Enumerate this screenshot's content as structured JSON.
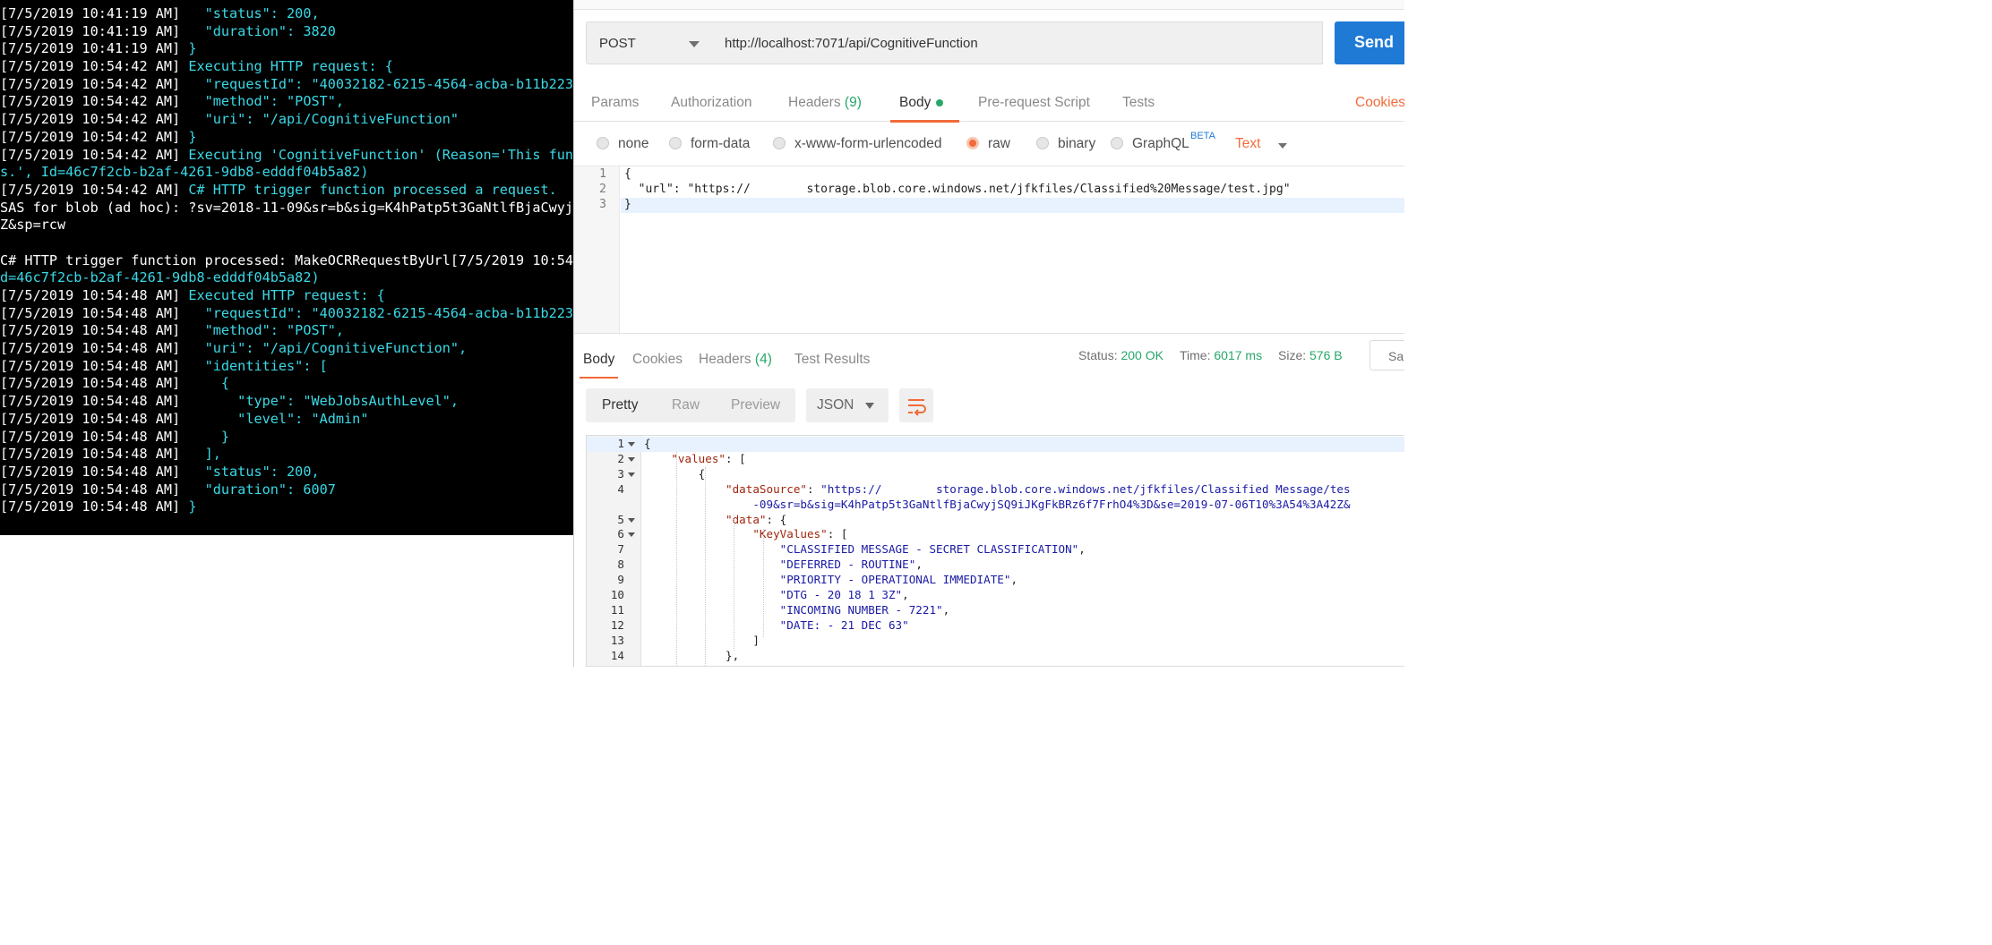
{
  "console": {
    "lines": [
      [
        {
          "t": "[7/5/2019 10:41:19 AM] ",
          "c": "ts"
        },
        {
          "t": "  \"status\": 200,",
          "c": "c"
        }
      ],
      [
        {
          "t": "[7/5/2019 10:41:19 AM] ",
          "c": "ts"
        },
        {
          "t": "  \"duration\": 3820",
          "c": "c"
        }
      ],
      [
        {
          "t": "[7/5/2019 10:41:19 AM] ",
          "c": "ts"
        },
        {
          "t": "}",
          "c": "c"
        }
      ],
      [
        {
          "t": "[7/5/2019 10:54:42 AM] ",
          "c": "ts"
        },
        {
          "t": "Executing HTTP request: {",
          "c": "c"
        }
      ],
      [
        {
          "t": "[7/5/2019 10:54:42 AM] ",
          "c": "ts"
        },
        {
          "t": "  \"requestId\": \"40032182-6215-4564-acba-b11b223",
          "c": "c"
        }
      ],
      [
        {
          "t": "[7/5/2019 10:54:42 AM] ",
          "c": "ts"
        },
        {
          "t": "  \"method\": \"POST\",",
          "c": "c"
        }
      ],
      [
        {
          "t": "[7/5/2019 10:54:42 AM] ",
          "c": "ts"
        },
        {
          "t": "  \"uri\": \"/api/CognitiveFunction\"",
          "c": "c"
        }
      ],
      [
        {
          "t": "[7/5/2019 10:54:42 AM] ",
          "c": "ts"
        },
        {
          "t": "}",
          "c": "c"
        }
      ],
      [
        {
          "t": "[7/5/2019 10:54:42 AM] ",
          "c": "ts"
        },
        {
          "t": "Executing 'CognitiveFunction' (Reason='This fun",
          "c": "c"
        }
      ],
      [
        {
          "t": "s.', Id=46c7f2cb-b2af-4261-9db8-edddf04b5a82)",
          "c": "c"
        }
      ],
      [
        {
          "t": "[7/5/2019 10:54:42 AM] ",
          "c": "ts"
        },
        {
          "t": "C# HTTP trigger function processed a request.",
          "c": "c"
        }
      ],
      [
        {
          "t": "SAS for blob (ad hoc): ?sv=2018-11-09&sr=b&sig=K4hPatp5t3GaNtlfBjaCwyj",
          "c": "w"
        }
      ],
      [
        {
          "t": "Z&sp=rcw",
          "c": "w"
        }
      ],
      [
        {
          "t": "",
          "c": "w"
        }
      ],
      [
        {
          "t": "C# HTTP trigger function processed: MakeOCRRequestByUrl[7/5/2019 10:54",
          "c": "w"
        }
      ],
      [
        {
          "t": "d=46c7f2cb-b2af-4261-9db8-edddf04b5a82)",
          "c": "c"
        }
      ],
      [
        {
          "t": "[7/5/2019 10:54:48 AM] ",
          "c": "ts"
        },
        {
          "t": "Executed HTTP request: {",
          "c": "c"
        }
      ],
      [
        {
          "t": "[7/5/2019 10:54:48 AM] ",
          "c": "ts"
        },
        {
          "t": "  \"requestId\": \"40032182-6215-4564-acba-b11b223",
          "c": "c"
        }
      ],
      [
        {
          "t": "[7/5/2019 10:54:48 AM] ",
          "c": "ts"
        },
        {
          "t": "  \"method\": \"POST\",",
          "c": "c"
        }
      ],
      [
        {
          "t": "[7/5/2019 10:54:48 AM] ",
          "c": "ts"
        },
        {
          "t": "  \"uri\": \"/api/CognitiveFunction\",",
          "c": "c"
        }
      ],
      [
        {
          "t": "[7/5/2019 10:54:48 AM] ",
          "c": "ts"
        },
        {
          "t": "  \"identities\": [",
          "c": "c"
        }
      ],
      [
        {
          "t": "[7/5/2019 10:54:48 AM] ",
          "c": "ts"
        },
        {
          "t": "    {",
          "c": "c"
        }
      ],
      [
        {
          "t": "[7/5/2019 10:54:48 AM] ",
          "c": "ts"
        },
        {
          "t": "      \"type\": \"WebJobsAuthLevel\",",
          "c": "c"
        }
      ],
      [
        {
          "t": "[7/5/2019 10:54:48 AM] ",
          "c": "ts"
        },
        {
          "t": "      \"level\": \"Admin\"",
          "c": "c"
        }
      ],
      [
        {
          "t": "[7/5/2019 10:54:48 AM] ",
          "c": "ts"
        },
        {
          "t": "    }",
          "c": "c"
        }
      ],
      [
        {
          "t": "[7/5/2019 10:54:48 AM] ",
          "c": "ts"
        },
        {
          "t": "  ],",
          "c": "c"
        }
      ],
      [
        {
          "t": "[7/5/2019 10:54:48 AM] ",
          "c": "ts"
        },
        {
          "t": "  \"status\": 200,",
          "c": "c"
        }
      ],
      [
        {
          "t": "[7/5/2019 10:54:48 AM] ",
          "c": "ts"
        },
        {
          "t": "  \"duration\": 6007",
          "c": "c"
        }
      ],
      [
        {
          "t": "[7/5/2019 10:54:48 AM] ",
          "c": "ts"
        },
        {
          "t": "}",
          "c": "c"
        }
      ]
    ]
  },
  "request": {
    "method": "POST",
    "url": "http://localhost:7071/api/CognitiveFunction",
    "send_label": "Send"
  },
  "request_tabs": {
    "params": "Params",
    "authorization": "Authorization",
    "headers": "Headers",
    "headers_count": "(9)",
    "body": "Body",
    "prerequest": "Pre-request Script",
    "tests": "Tests",
    "cookies": "Cookies"
  },
  "body_types": {
    "none": "none",
    "form_data": "form-data",
    "urlencoded": "x-www-form-urlencoded",
    "raw": "raw",
    "binary": "binary",
    "graphql": "GraphQL",
    "beta": "BETA",
    "text": "Text"
  },
  "request_body": {
    "lines": [
      "{",
      "  \"url\": \"https://        storage.blob.core.windows.net/jfkfiles/Classified%20Message/test.jpg\"",
      "}"
    ]
  },
  "response_tabs": {
    "body": "Body",
    "cookies": "Cookies",
    "headers": "Headers",
    "headers_count": "(4)",
    "test_results": "Test Results"
  },
  "response_meta": {
    "status_label": "Status:",
    "status_value": "200 OK",
    "time_label": "Time:",
    "time_value": "6017 ms",
    "size_label": "Size:",
    "size_value": "576 B",
    "save_label": "Sa"
  },
  "response_view": {
    "pretty": "Pretty",
    "raw": "Raw",
    "preview": "Preview",
    "format": "JSON"
  },
  "response_body": {
    "lines": [
      {
        "n": "1",
        "fold": true,
        "segs": [
          {
            "t": "{",
            "c": "punc"
          }
        ]
      },
      {
        "n": "2",
        "fold": true,
        "segs": [
          {
            "t": "    ",
            "c": "punc"
          },
          {
            "t": "\"values\"",
            "c": "key"
          },
          {
            "t": ": [",
            "c": "punc"
          }
        ]
      },
      {
        "n": "3",
        "fold": true,
        "segs": [
          {
            "t": "        {",
            "c": "punc"
          }
        ]
      },
      {
        "n": "4",
        "fold": false,
        "segs": [
          {
            "t": "            ",
            "c": "punc"
          },
          {
            "t": "\"dataSource\"",
            "c": "key"
          },
          {
            "t": ": ",
            "c": "punc"
          },
          {
            "t": "\"https://        storage.blob.core.windows.net/jfkfiles/Classified Message/tes",
            "c": "str"
          }
        ]
      },
      {
        "n": "",
        "fold": false,
        "segs": [
          {
            "t": "                ",
            "c": "punc"
          },
          {
            "t": "-09&sr=b&sig=K4hPatp5t3GaNtlfBjaCwyjSQ9iJKgFkBRz6f7FrhO4%3D&se=2019-07-06T10%3A54%3A42Z&",
            "c": "str"
          }
        ]
      },
      {
        "n": "5",
        "fold": true,
        "segs": [
          {
            "t": "            ",
            "c": "punc"
          },
          {
            "t": "\"data\"",
            "c": "key"
          },
          {
            "t": ": {",
            "c": "punc"
          }
        ]
      },
      {
        "n": "6",
        "fold": true,
        "segs": [
          {
            "t": "                ",
            "c": "punc"
          },
          {
            "t": "\"KeyValues\"",
            "c": "key"
          },
          {
            "t": ": [",
            "c": "punc"
          }
        ]
      },
      {
        "n": "7",
        "fold": false,
        "segs": [
          {
            "t": "                    ",
            "c": "punc"
          },
          {
            "t": "\"CLASSIFIED MESSAGE - SECRET CLASSIFICATION\"",
            "c": "str"
          },
          {
            "t": ",",
            "c": "punc"
          }
        ]
      },
      {
        "n": "8",
        "fold": false,
        "segs": [
          {
            "t": "                    ",
            "c": "punc"
          },
          {
            "t": "\"DEFERRED - ROUTINE\"",
            "c": "str"
          },
          {
            "t": ",",
            "c": "punc"
          }
        ]
      },
      {
        "n": "9",
        "fold": false,
        "segs": [
          {
            "t": "                    ",
            "c": "punc"
          },
          {
            "t": "\"PRIORITY - OPERATIONAL IMMEDIATE\"",
            "c": "str"
          },
          {
            "t": ",",
            "c": "punc"
          }
        ]
      },
      {
        "n": "10",
        "fold": false,
        "segs": [
          {
            "t": "                    ",
            "c": "punc"
          },
          {
            "t": "\"DTG - 20 18 1 3Z\"",
            "c": "str"
          },
          {
            "t": ",",
            "c": "punc"
          }
        ]
      },
      {
        "n": "11",
        "fold": false,
        "segs": [
          {
            "t": "                    ",
            "c": "punc"
          },
          {
            "t": "\"INCOMING NUMBER - 7221\"",
            "c": "str"
          },
          {
            "t": ",",
            "c": "punc"
          }
        ]
      },
      {
        "n": "12",
        "fold": false,
        "segs": [
          {
            "t": "                    ",
            "c": "punc"
          },
          {
            "t": "\"DATE: - 21 DEC 63\"",
            "c": "str"
          }
        ]
      },
      {
        "n": "13",
        "fold": false,
        "segs": [
          {
            "t": "                ]",
            "c": "punc"
          }
        ]
      },
      {
        "n": "14",
        "fold": false,
        "segs": [
          {
            "t": "            },",
            "c": "punc"
          }
        ]
      }
    ]
  },
  "colors": {
    "accent": "#f26b3a",
    "send": "#1f7ad6",
    "success": "#27a869",
    "console_cyan": "#3ad9e6"
  }
}
